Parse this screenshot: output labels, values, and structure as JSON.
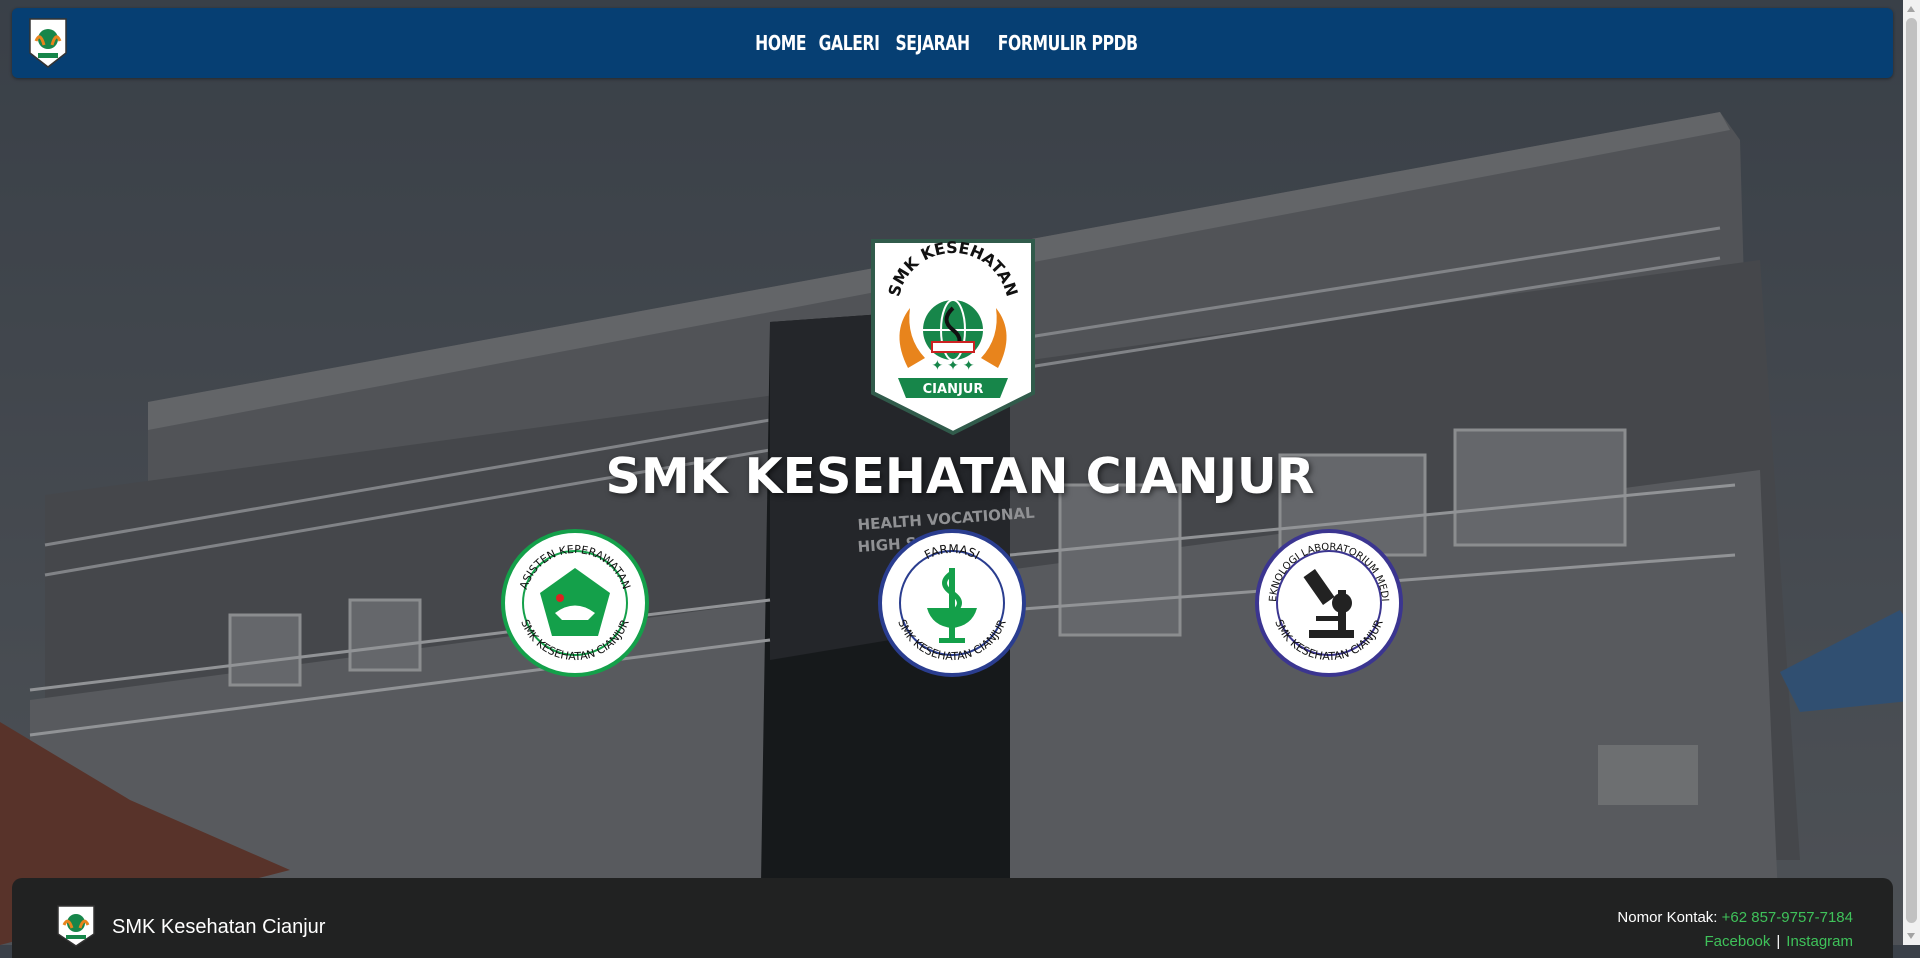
{
  "nav": {
    "links": [
      "HOME",
      "GALERI",
      "SEJARAH",
      "FORMULIR PPDB"
    ]
  },
  "hero": {
    "title": "SMK KESEHATAN CIANJUR",
    "crest": {
      "ring_text": "SMK KESEHATAN",
      "banner_text": "CIANJUR"
    },
    "building_sign": [
      "HEALTH VOCATIONAL",
      "HIGH SCHOOL"
    ],
    "departments": [
      {
        "top_text": "ASISTEN KEPERAWATAN",
        "bottom_text": "SMK KESEHATAN CIANJUR",
        "color": "#14a04a"
      },
      {
        "top_text": "FARMASI",
        "bottom_text": "SMK KESEHATAN CIANJUR",
        "color": "#2a3d8f"
      },
      {
        "top_text": "TEKNOLOGI LABORATORIUM MEDIK",
        "bottom_text": "SMK KESEHATAN CIANJUR",
        "color": "#3b3590"
      }
    ]
  },
  "footer": {
    "brand": "SMK Kesehatan Cianjur",
    "contact_label": "Nomor Kontak:",
    "phone": "+62 857-9757-7184",
    "social": [
      "Facebook",
      "Instagram"
    ],
    "separator": "|"
  },
  "colors": {
    "navbar": "#063f73",
    "footer": "#212222",
    "link_green": "#3fc25a",
    "crest_green": "#17864a",
    "crest_orange": "#e8841c"
  }
}
